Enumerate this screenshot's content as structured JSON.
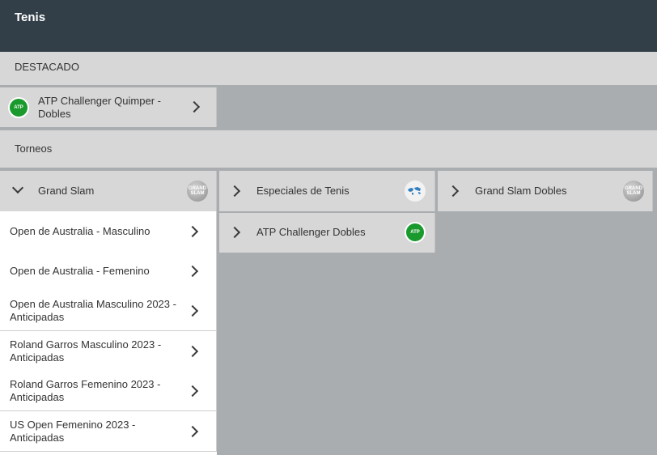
{
  "header": {
    "title": "Tenis"
  },
  "featured": {
    "section_label": "DESTACADO",
    "items": [
      {
        "label": "ATP Challenger Quimper - Dobles",
        "icon": "atp-challenger-logo-icon"
      }
    ]
  },
  "tournaments": {
    "section_label": "Torneos",
    "categories": [
      {
        "label": "Grand Slam",
        "expanded": true,
        "icon": "grand-slam-logo-icon",
        "badge_text": "GRAND SLAM"
      },
      {
        "label": "Especiales de Tenis",
        "expanded": false,
        "icon": "globe-map-icon"
      },
      {
        "label": "Grand Slam Dobles",
        "expanded": false,
        "icon": "grand-slam-logo-icon",
        "badge_text": "GRAND SLAM"
      },
      {
        "label": "ATP Challenger Dobles",
        "expanded": false,
        "icon": "atp-challenger-logo-icon"
      }
    ],
    "grand_slam_items": [
      {
        "label": "Open de Australia - Masculino"
      },
      {
        "label": "Open de Australia - Femenino"
      },
      {
        "label": "Open de Australia Masculino 2023 - Anticipadas"
      },
      {
        "label": "Roland Garros Masculino 2023 - Anticipadas"
      },
      {
        "label": "Roland Garros Femenino 2023 - Anticipadas"
      },
      {
        "label": "US Open Femenino 2023 - Anticipadas"
      }
    ]
  },
  "colors": {
    "header_bg": "#323f48",
    "section_bg": "#d7d7d7",
    "page_bg": "#a9adb0",
    "atp_green": "#1a9a2c"
  }
}
